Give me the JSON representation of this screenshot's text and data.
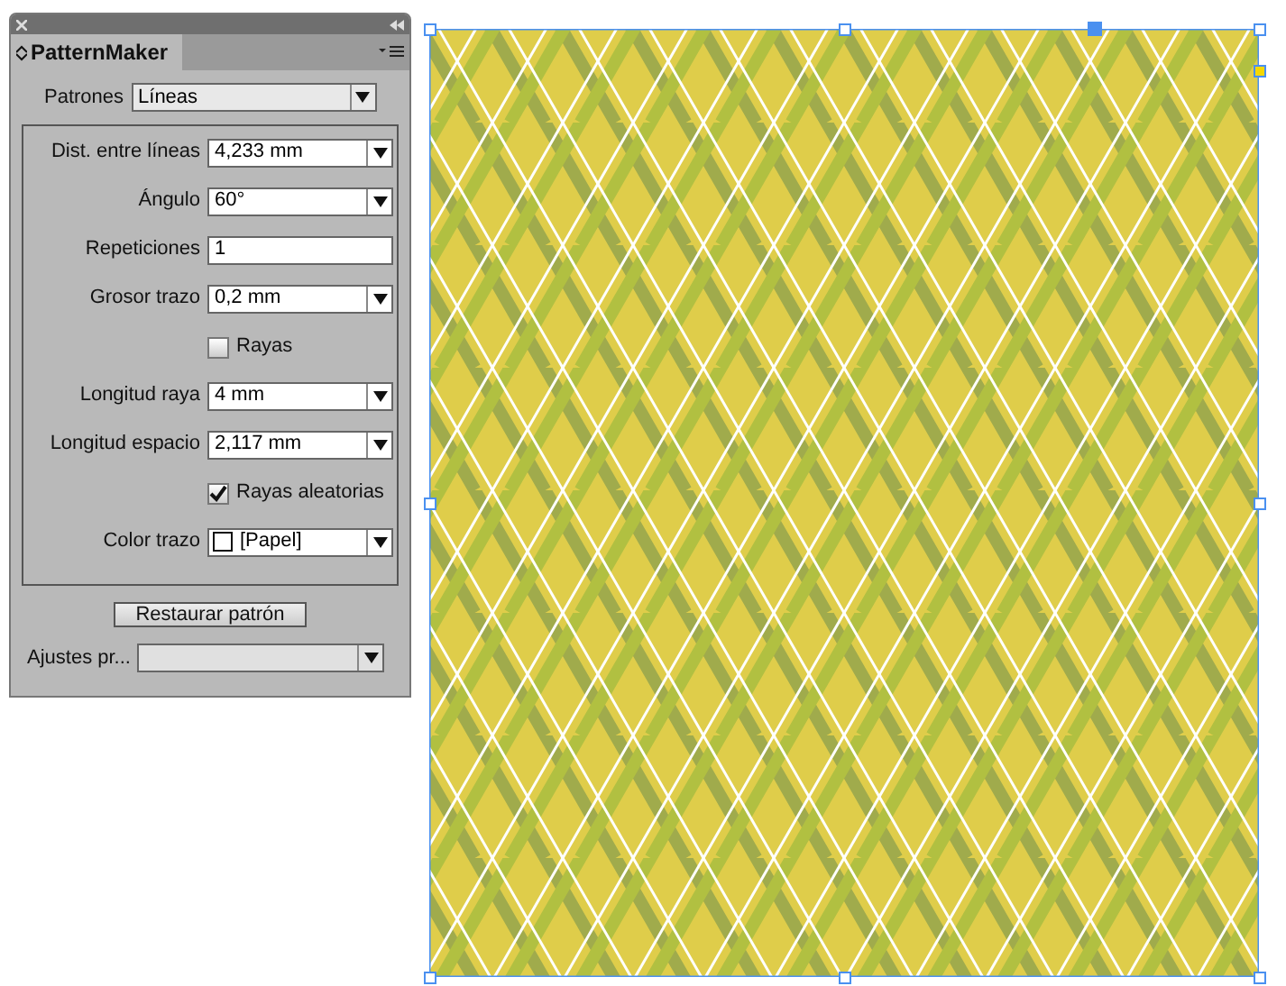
{
  "panel": {
    "tab_title": "PatternMaker",
    "pattern": {
      "label": "Patrones",
      "value": "Líneas"
    },
    "fields": [
      {
        "kind": "select",
        "label": "Dist. entre líneas",
        "value": "4,233 mm"
      },
      {
        "kind": "select",
        "label": "Ángulo",
        "value": "60°"
      },
      {
        "kind": "text",
        "label": "Repeticiones",
        "value": "1"
      },
      {
        "kind": "select",
        "label": "Grosor trazo",
        "value": "0,2 mm"
      },
      {
        "kind": "checkbox",
        "label": "Rayas",
        "checked": false
      },
      {
        "kind": "select",
        "label": "Longitud raya",
        "value": "4 mm"
      },
      {
        "kind": "select",
        "label": "Longitud espacio",
        "value": "2,117 mm"
      },
      {
        "kind": "checkbox",
        "label": "Rayas aleatorias",
        "checked": true
      },
      {
        "kind": "color",
        "label": "Color trazo",
        "value": "[Papel]",
        "color": "#ffffff"
      }
    ],
    "reset_button": "Restaurar patrón",
    "presets": {
      "label": "Ajustes pr..."
    }
  }
}
